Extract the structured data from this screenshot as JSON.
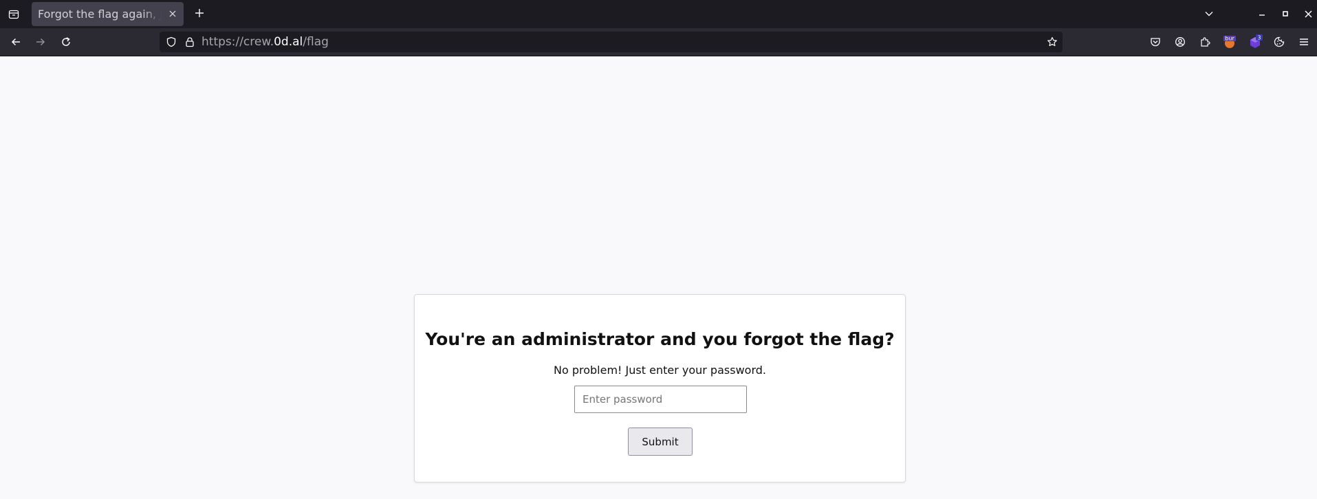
{
  "browser": {
    "tab": {
      "title": "Forgot the flag again, Jo"
    },
    "url": {
      "scheme_prefix": "https://crew.",
      "host": "0d.al",
      "path": "/flag"
    },
    "extensions": {
      "burp_label": "bur",
      "badge_count": "3"
    },
    "colors": {
      "chrome_dark": "#1c1b22",
      "toolbar": "#2b2a33",
      "active_tab": "#42414d"
    }
  },
  "page": {
    "heading": "You're an administrator and you forgot the flag?",
    "subtext": "No problem! Just enter your password.",
    "password_input": {
      "placeholder": "Enter password",
      "value": ""
    },
    "submit_label": "Submit"
  }
}
